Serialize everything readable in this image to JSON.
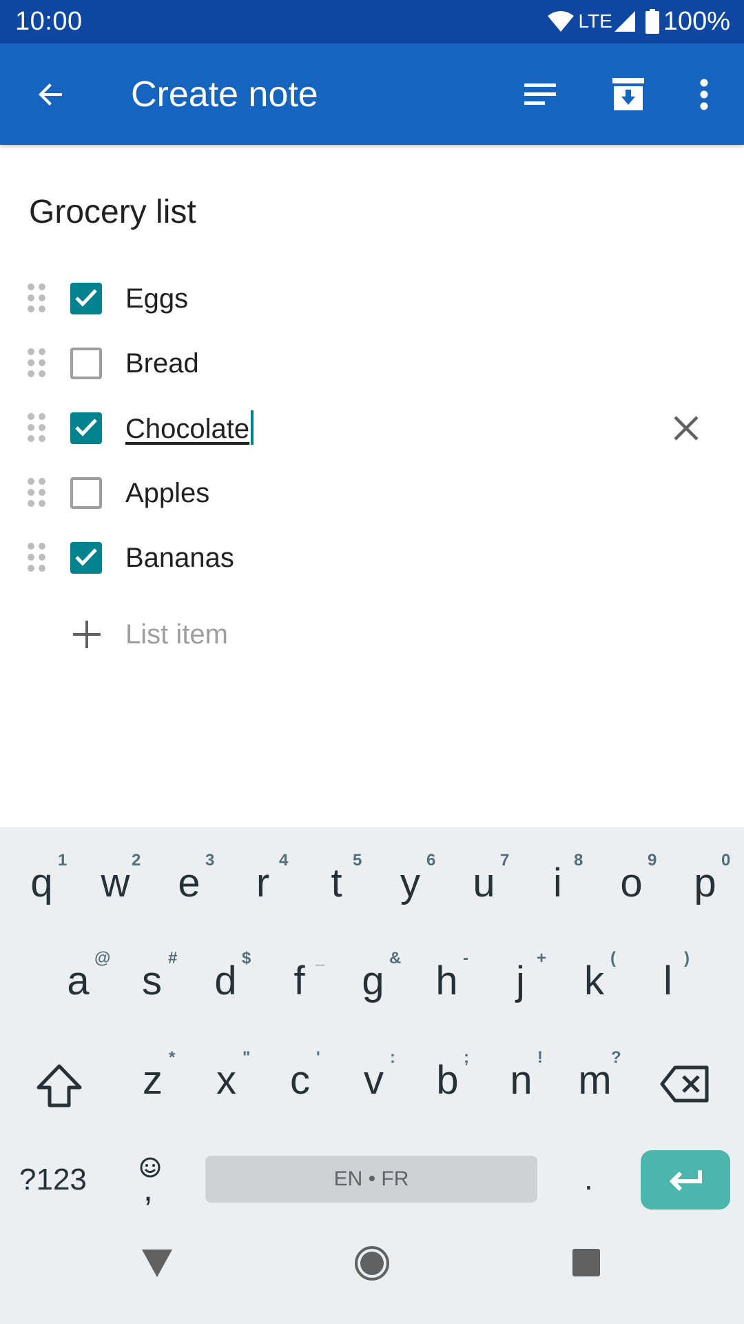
{
  "status_bar": {
    "time": "10:00",
    "network": "LTE",
    "battery": "100%"
  },
  "app_bar": {
    "title": "Create note",
    "back_icon": "arrow-back-icon",
    "actions": [
      "sort-icon",
      "archive-icon",
      "more-vert-icon"
    ],
    "background": "#1565c0"
  },
  "note": {
    "title": "Grocery list",
    "items": [
      {
        "label": "Eggs",
        "checked": true
      },
      {
        "label": "Bread",
        "checked": false
      },
      {
        "label": "Chocolate",
        "checked": true,
        "editing": true
      },
      {
        "label": "Apples",
        "checked": false
      },
      {
        "label": "Bananas",
        "checked": true
      }
    ],
    "add_item_placeholder": "List item",
    "accent": "#00838f"
  },
  "keyboard": {
    "row1": [
      {
        "key": "q",
        "hint": "1"
      },
      {
        "key": "w",
        "hint": "2"
      },
      {
        "key": "e",
        "hint": "3"
      },
      {
        "key": "r",
        "hint": "4"
      },
      {
        "key": "t",
        "hint": "5"
      },
      {
        "key": "y",
        "hint": "6"
      },
      {
        "key": "u",
        "hint": "7"
      },
      {
        "key": "i",
        "hint": "8"
      },
      {
        "key": "o",
        "hint": "9"
      },
      {
        "key": "p",
        "hint": "0"
      }
    ],
    "row2": [
      {
        "key": "a",
        "hint": "@"
      },
      {
        "key": "s",
        "hint": "#"
      },
      {
        "key": "d",
        "hint": "$"
      },
      {
        "key": "f",
        "hint": "_"
      },
      {
        "key": "g",
        "hint": "&"
      },
      {
        "key": "h",
        "hint": "-"
      },
      {
        "key": "j",
        "hint": "+"
      },
      {
        "key": "k",
        "hint": "("
      },
      {
        "key": "l",
        "hint": ")"
      }
    ],
    "row3": [
      {
        "key": "z",
        "hint": "*"
      },
      {
        "key": "x",
        "hint": "\""
      },
      {
        "key": "c",
        "hint": "'"
      },
      {
        "key": "v",
        "hint": ":"
      },
      {
        "key": "b",
        "hint": ";"
      },
      {
        "key": "n",
        "hint": "!"
      },
      {
        "key": "m",
        "hint": "?"
      }
    ],
    "symbols_label": "?123",
    "comma": ",",
    "space_label": "EN • FR",
    "period": ".",
    "enter_color": "#4db6ac"
  }
}
